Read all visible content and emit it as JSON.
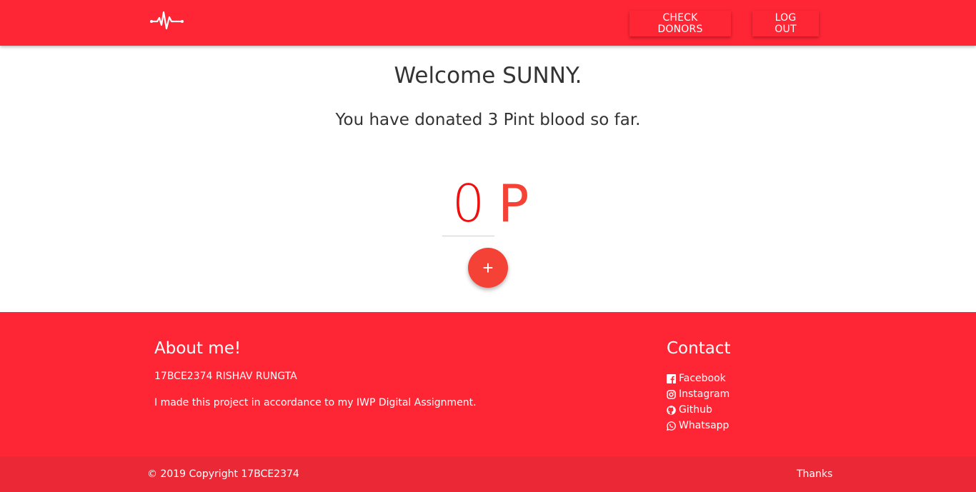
{
  "header": {
    "logo_icon": "heartbeat-icon",
    "check_donors_label": "CHECK DONORS",
    "logout_label": "LOG OUT"
  },
  "main": {
    "welcome_text": "Welcome SUNNY.",
    "donated_text": "You have donated 3 Pint blood so far.",
    "counter_value": "0",
    "counter_unit": "P",
    "add_button_label": "+"
  },
  "footer": {
    "about_title": "About me!",
    "about_id_line": "17BCE2374 RISHAV RUNGTA",
    "about_description": "I made this project in accordance to my IWP Digital Assignment.",
    "contact_title": "Contact",
    "contacts": [
      {
        "label": "Facebook",
        "icon": "facebook-icon"
      },
      {
        "label": "Instagram",
        "icon": "instagram-icon"
      },
      {
        "label": "Github",
        "icon": "github-icon"
      },
      {
        "label": "Whatsapp",
        "icon": "whatsapp-icon"
      }
    ]
  },
  "bottom_bar": {
    "copyright": "© 2019 Copyright 17BCE2374",
    "thanks_label": "Thanks"
  },
  "colors": {
    "primary_red": "#fe2535",
    "footer_bottom": "#ea2836",
    "accent": "#f44336",
    "counter_red": "#f00f0f"
  }
}
